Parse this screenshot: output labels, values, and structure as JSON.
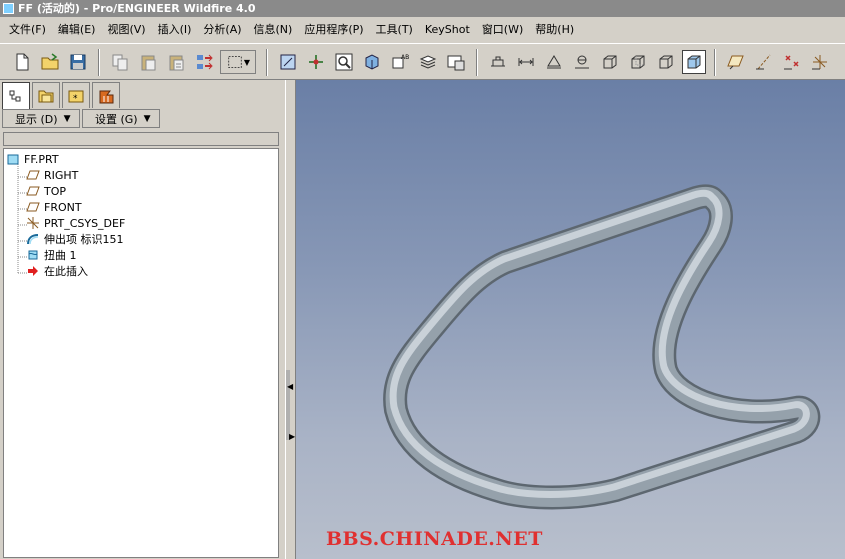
{
  "window": {
    "title": "FF (活动的) - Pro/ENGINEER Wildfire 4.0"
  },
  "menu": [
    "文件(F)",
    "编辑(E)",
    "视图(V)",
    "插入(I)",
    "分析(A)",
    "信息(N)",
    "应用程序(P)",
    "工具(T)",
    "KeyShot",
    "窗口(W)",
    "帮助(H)"
  ],
  "toolbar": {
    "icons": [
      "new-file-icon",
      "open-folder-icon",
      "save-icon",
      "copy-icon",
      "paste-icon",
      "paste-special-icon",
      "regenerate-icon",
      "select-box-icon",
      "repaint-icon",
      "spin-center-icon",
      "zoom-window-icon",
      "orient-icon",
      "view-manager-icon",
      "layers-icon",
      "saved-views-icon",
      "shading-icon-1",
      "shading-icon-2",
      "shading-icon-3",
      "shading-icon-4",
      "wireframe-icon",
      "hidden-line-icon",
      "no-hidden-icon",
      "shaded-icon",
      "datum-planes-icon",
      "datum-axes-icon",
      "datum-points-icon",
      "coord-sys-icon"
    ]
  },
  "navigator": {
    "tabs": [
      "model-tree-tab",
      "folder-browser-tab",
      "favorites-tab",
      "connections-tab"
    ],
    "display_label": "显示 (D)",
    "settings_label": "设置 (G)",
    "tree": [
      {
        "label": "FF.PRT",
        "icon": "part-icon"
      },
      {
        "label": "RIGHT",
        "icon": "datum-plane-icon"
      },
      {
        "label": "TOP",
        "icon": "datum-plane-icon"
      },
      {
        "label": "FRONT",
        "icon": "datum-plane-icon"
      },
      {
        "label": "PRT_CSYS_DEF",
        "icon": "csys-icon"
      },
      {
        "label": "伸出项 标识151",
        "icon": "protrusion-icon"
      },
      {
        "label": "扭曲 1",
        "icon": "warp-icon"
      },
      {
        "label": "在此插入",
        "icon": "insert-here-arrow-icon"
      }
    ]
  },
  "viewport": {
    "watermark": "BBS.CHINADE.NET"
  }
}
